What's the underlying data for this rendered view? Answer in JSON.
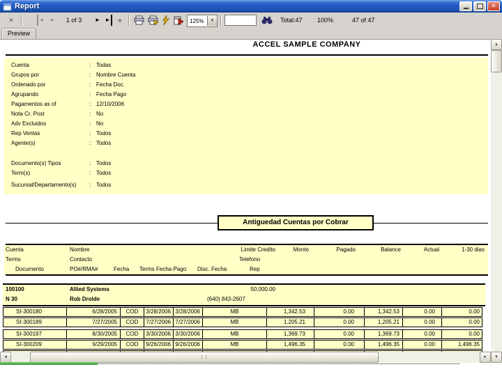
{
  "window": {
    "title": "Report"
  },
  "titlebar": {
    "minimize_glyph": "",
    "restore_glyph": "",
    "close_glyph": "✕"
  },
  "toolbar": {
    "close_glyph": "✕",
    "nav_first_glyph": "◄",
    "nav_prev_glyph": "◄",
    "page_indicator": "1 of 3",
    "nav_next_glyph": "►",
    "nav_last_glyph": "►",
    "stop_glyph": "■",
    "zoom_value": "125%",
    "dropdown_glyph": "▼",
    "search_value": "",
    "status_total": "Total:47",
    "status_percent": "100%",
    "status_records": "47 of 47"
  },
  "tab": {
    "label": "Preview"
  },
  "scrollbars": {
    "up": "▲",
    "down": "▼",
    "left": "◄",
    "right": "►",
    "grip": "| |"
  },
  "report": {
    "company": "ACCEL SAMPLE COMPANY",
    "colon": ":",
    "parameters": [
      {
        "label": "Cuenta",
        "value": "Todas"
      },
      {
        "label": "Grupos por",
        "value": "Nombre Cuenta"
      },
      {
        "label": "Ordenado por",
        "value": "Fecha Doc."
      },
      {
        "label": "Agrupando",
        "value": "Fecha Pago"
      },
      {
        "label": "Pagamentos as of",
        "value": "12/10/2006"
      },
      {
        "label": "Nota Cr. Post",
        "value": "No"
      },
      {
        "label": "Adv Excluidos",
        "value": "No"
      },
      {
        "label": "Rep Ventas",
        "value": "Todos"
      },
      {
        "label": "Agente(s)",
        "value": "Todos"
      }
    ],
    "parameters2": [
      {
        "label": "Documento(s) Tipos",
        "value": "Todos"
      },
      {
        "label": "Term(s)",
        "value": "Todos"
      },
      {
        "label": "Sucursal/Departamento(s)",
        "value": "Todos"
      }
    ],
    "title": "Antiguedad Cuentas por Cobrar",
    "header": {
      "row1": {
        "cuenta": "Cuenta",
        "nombre": "Nombre",
        "limite": "Limite Credito",
        "monto": "Monto",
        "pagado": "Pagado",
        "balance": "Balance",
        "actual": "Actual",
        "dias": "1-30 dias"
      },
      "row2": {
        "terms": "Terms",
        "contacto": "Contacto",
        "telefono": "Telefono"
      },
      "row3": {
        "documento": "Documento",
        "po": "PO#/RMA#",
        "fecha": "Fecha",
        "terms_fecha_pago": "Terms Fecha Pago",
        "disc_fecha": "Disc. Fecha",
        "rep": "Rep"
      }
    },
    "group": {
      "account": "100100",
      "name": "Allied Systems",
      "credit_limit": "50,000.00",
      "terms": "N 30",
      "contact": "Rob Drolde",
      "phone": "(640) 843-2607"
    },
    "rows": [
      {
        "doc": "SI-300180",
        "fecha": "6/28/2005",
        "terms": "COD",
        "fecha_pago": "3/28/2006",
        "disc_fecha": "3/28/2006",
        "rep": "MB",
        "monto": "1,342.53",
        "pagado": "0.00",
        "balance": "1,342.53",
        "actual": "0.00",
        "dias_1_30": "0.00"
      },
      {
        "doc": "SI-300189",
        "fecha": "7/27/2005",
        "terms": "COD",
        "fecha_pago": "7/27/2006",
        "disc_fecha": "7/27/2006",
        "rep": "MB",
        "monto": "1,205.21",
        "pagado": "0.00",
        "balance": "1,205.21",
        "actual": "0.00",
        "dias_1_30": "0.00"
      },
      {
        "doc": "SI-300197",
        "fecha": "8/30/2005",
        "terms": "COD",
        "fecha_pago": "3/30/2006",
        "disc_fecha": "3/30/2006",
        "rep": "MB",
        "monto": "1,369.73",
        "pagado": "0.00",
        "balance": "1,369.73",
        "actual": "0.00",
        "dias_1_30": "0.00"
      },
      {
        "doc": "SI-300209",
        "fecha": "9/29/2005",
        "terms": "COD",
        "fecha_pago": "9/26/2006",
        "disc_fecha": "9/26/2006",
        "rep": "MB",
        "monto": "1,496.35",
        "pagado": "0.00",
        "balance": "1,496.35",
        "actual": "0.00",
        "dias_1_30": "1,496.35"
      }
    ]
  },
  "colors": {
    "titlebar_blue": "#1e56c0",
    "toolbar_gray": "#d6d3ce",
    "page_yellow": "#ffffc6",
    "close_button_red": "#c6402a",
    "background_green_sliver": "#2e8f2e"
  }
}
